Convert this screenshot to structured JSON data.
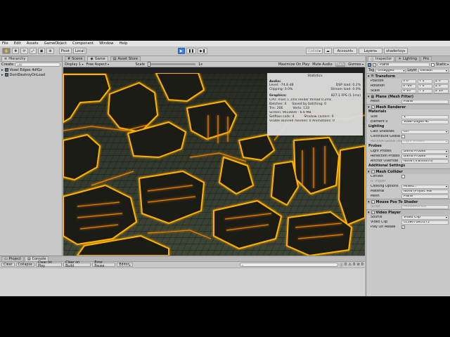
{
  "menu": [
    "File",
    "Edit",
    "Assets",
    "GameObject",
    "Component",
    "Window",
    "Help"
  ],
  "toolbar": {
    "pivot": "Pivot",
    "local": "Local",
    "collab": "Collab",
    "account": "Account",
    "layers": "Layers",
    "layout": "shadertoy"
  },
  "hierarchy": {
    "tab": "Hierarchy",
    "create": "Create",
    "search_placeholder": "All",
    "items": [
      "Voxel Edges 4dfGz",
      "DontDestroyOnLoad"
    ]
  },
  "view_tabs": [
    "Scene",
    "Game",
    "Asset Store"
  ],
  "gamebar": {
    "display": "Display 1",
    "aspect": "Free Aspect",
    "scale_label": "Scale",
    "scale_value": "1x",
    "maximize": "Maximize On Play",
    "mute": "Mute Audio",
    "stats": "Stats",
    "gizmos": "Gizmos"
  },
  "stats": {
    "title": "Statistics",
    "audio_header": "Audio:",
    "level": "Level: -74.8 dB",
    "dsp": "DSP load: 0.2%",
    "clipping": "Clipping: 0.0%",
    "stream": "Stream load: 0.0%",
    "graphics_header": "Graphics:",
    "fps": "827.1 FPS (1.1ms)",
    "cpu": "CPU: main 1.1ms  render thread 0.2ms",
    "batches": "Batches: 4",
    "saved": "Saved by batching: 0",
    "tris": "Tris: 206",
    "verts": "Verts: 133",
    "screen": "Screen: 961x604 - 6.6 MB",
    "setpass": "SetPass calls: 4",
    "shadow": "Shadow casters: 0",
    "skinned": "Visible skinned meshes: 0  Animations: 0"
  },
  "inspector": {
    "tabs": [
      "Inspector",
      "Lighting",
      "Pro"
    ],
    "object_name": "Plane",
    "static": "Static",
    "tag_label": "Tag",
    "tag": "Untagged",
    "layer_label": "Layer",
    "layer": "Default",
    "transform": {
      "title": "Transform",
      "position": {
        "label": "Position",
        "x": "X 0",
        "y": "Y 1",
        "z": "Z 0"
      },
      "rotation": {
        "label": "Rotation",
        "x": "X -90",
        "y": "Y 0",
        "z": "Z 0"
      },
      "scale": {
        "label": "Scale",
        "x": "X 10",
        "y": "Y 1",
        "z": "Z 10"
      }
    },
    "meshfilter": {
      "title": "Plane (Mesh Filter)",
      "mesh_label": "Mesh",
      "mesh": "Plane"
    },
    "renderer": {
      "title": "Mesh Renderer",
      "materials": "Materials",
      "size_label": "Size",
      "size": "1",
      "element_label": "Element 0",
      "element": "Voxel Edges 4c",
      "lighting": "Lighting",
      "cast_label": "Cast Shadows",
      "cast": "On",
      "contribute_label": "Contribute Global I",
      "receive_label": "Receive Global Illu",
      "receive": "Light Probes",
      "probes": "Probes",
      "lightprobes_label": "Light Probes",
      "lightprobes": "Blend Probes",
      "reflection_label": "Reflection Probes",
      "reflection": "Blend Probes",
      "anchor_label": "Anchor Override",
      "anchor": "None (Transform)",
      "additional": "Additional Settings"
    },
    "collider": {
      "title": "Mesh Collider",
      "convex": "Convex",
      "trigger": "Is Trigger",
      "cooking_label": "Cooking Options",
      "cooking": "Mixed...",
      "material_label": "Material",
      "material": "None (Physic Ma",
      "mesh_label": "Mesh",
      "mesh": "Plane"
    },
    "mousepos": {
      "title": "Mouse Pos To Shader",
      "script_label": "Script",
      "script": "MousePosToS"
    },
    "video": {
      "title": "Video Player",
      "source_label": "Source",
      "source": "Video Clip",
      "clip_label": "Video Clip",
      "clip": "cc3a071ecf273",
      "awake_label": "Play On Awake"
    }
  },
  "console": {
    "tabs": [
      "Project",
      "Console"
    ],
    "buttons": [
      "Clear",
      "Collapse",
      "Clear on Play",
      "Clear on Build",
      "Error Pause",
      "Editor"
    ],
    "counts": [
      "0",
      "0",
      "0"
    ]
  },
  "colors": {
    "accent": "#3e7de0",
    "glow": "#ffb000",
    "panel": "#c8c8c8"
  }
}
